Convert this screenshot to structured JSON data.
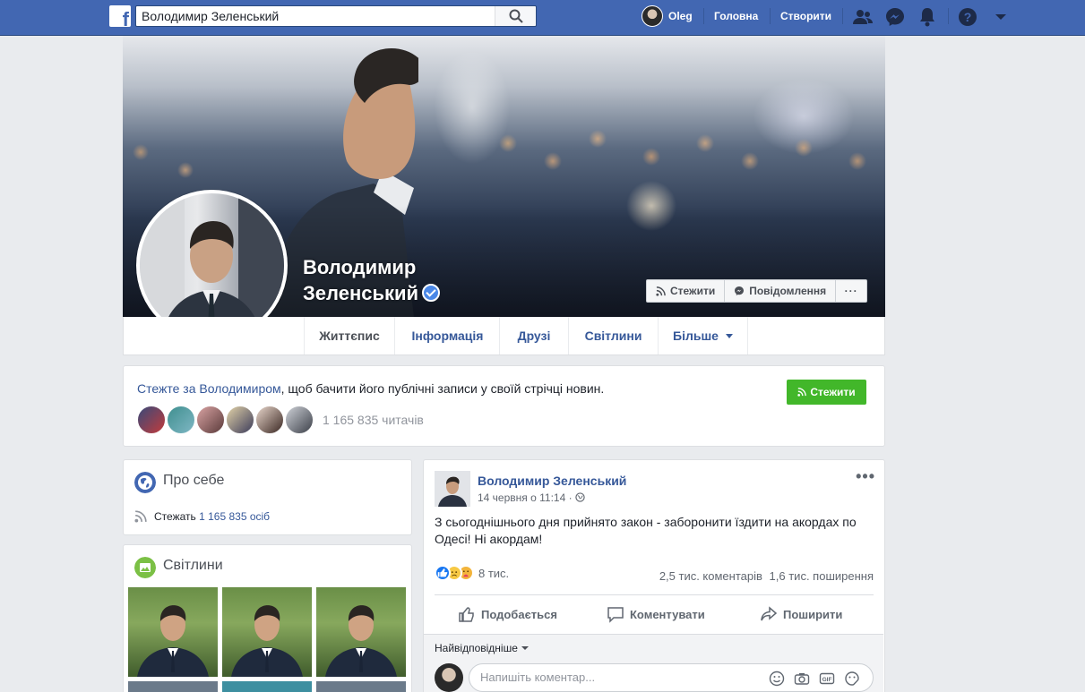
{
  "topbar": {
    "logo": "f",
    "search_value": "Володимир Зеленський",
    "user_name": "Oleg",
    "home_label": "Головна",
    "create_label": "Створити"
  },
  "profile": {
    "name_line1": "Володимир",
    "name_line2": "Зеленський",
    "follow_label": "Стежити",
    "message_label": "Повідомлення",
    "more_dots": "···"
  },
  "tabs": [
    {
      "label": "Життєпис"
    },
    {
      "label": "Інформація"
    },
    {
      "label": "Друзі"
    },
    {
      "label": "Світлини"
    },
    {
      "label": "Більше"
    }
  ],
  "follow_box": {
    "link_text": "Стежте за Володимиром",
    "rest_text": ", щоб бачити його публічні записи у своїй стрічці новин.",
    "button_label": "Стежити",
    "followers_count": "1 165 835 читачів"
  },
  "about": {
    "title": "Про себе",
    "follow_prefix": "Стежать",
    "follow_count": "1 165 835 осіб"
  },
  "photos": {
    "title": "Світлини"
  },
  "post": {
    "author": "Володимир Зеленський",
    "time": "14 червня о 11:14 · ",
    "dots": "•••",
    "text": "З сьогоднішнього дня прийнято закон - заборонити їздити на акордах по Одесі! Ні акордам!",
    "reactions_count": "8 тис.",
    "comments_count": "2,5 тис. коментарів",
    "shares_count": "1,6 тис. поширення",
    "like_label": "Подобається",
    "comment_label": "Коментувати",
    "share_label": "Поширити",
    "sort_label": "Найвідповідніше",
    "comment_placeholder": "Напишіть коментар..."
  },
  "colors": {
    "brand": "#4267b2",
    "link": "#365899",
    "follow_green": "#42b72a",
    "verified": "#4b88e7"
  }
}
